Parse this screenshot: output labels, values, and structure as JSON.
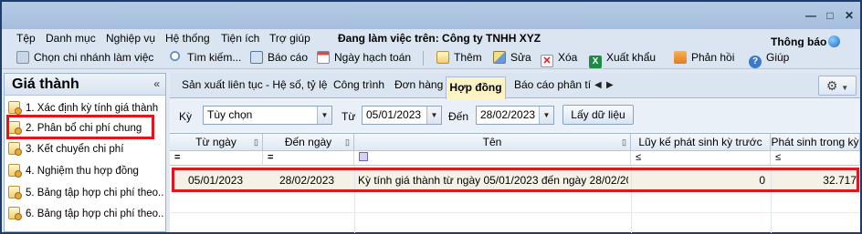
{
  "menu": {
    "items": [
      "Tệp",
      "Danh mục",
      "Nghiệp vụ",
      "Hệ thống",
      "Tiện ích",
      "Trợ giúp"
    ],
    "working_on": "Đang làm việc trên: Công ty TNHH XYZ",
    "notice": "Thông báo"
  },
  "toolbar": {
    "select_branch": "Chọn chi nhánh làm việc",
    "search": "Tìm kiếm...",
    "report": "Báo cáo",
    "posting_date": "Ngày hạch toán",
    "add": "Thêm",
    "edit": "Sửa",
    "delete": "Xóa",
    "export": "Xuất khẩu",
    "feedback": "Phản hồi",
    "help": "Giúp"
  },
  "left_panel": {
    "title": "Giá thành",
    "items": [
      "1. Xác định kỳ tính giá thành",
      "2. Phân bổ chi phí chung",
      "3. Kết chuyển chi phí",
      "4. Nghiệm thu hợp đồng",
      "5. Bảng tập hợp chi phí theo...",
      "6. Bảng tập hợp chi phí theo..."
    ]
  },
  "tabs": {
    "items": [
      "Sản xuất liên tục - Hệ số, tỷ lệ",
      "Công trình",
      "Đơn hàng",
      "Hợp đồng",
      "Báo cáo phân tích"
    ],
    "active": "Hợp đồng"
  },
  "filter": {
    "period_label": "Kỳ",
    "period_value": "Tùy chọn",
    "from_label": "Từ",
    "from_value": "05/01/2023",
    "to_label": "Đến",
    "to_value": "28/02/2023",
    "fetch_button": "Lấy dữ liệu"
  },
  "grid": {
    "columns": [
      "Từ ngày",
      "Đến ngày",
      "Tên",
      "Lũy kế phát sinh kỳ trước",
      "Phát sinh trong kỳ"
    ],
    "filter_ops": [
      "=",
      "=",
      "",
      "≤",
      "≤"
    ],
    "rows": [
      [
        "05/01/2023",
        "28/02/2023",
        "Kỳ tính giá thành từ ngày 05/01/2023 đến ngày 28/02/20",
        "0",
        "32.717"
      ]
    ]
  },
  "colors": {
    "highlight": "#e2151c",
    "active_tab": "#fdf3c5",
    "frame": "#1c3e6e"
  }
}
